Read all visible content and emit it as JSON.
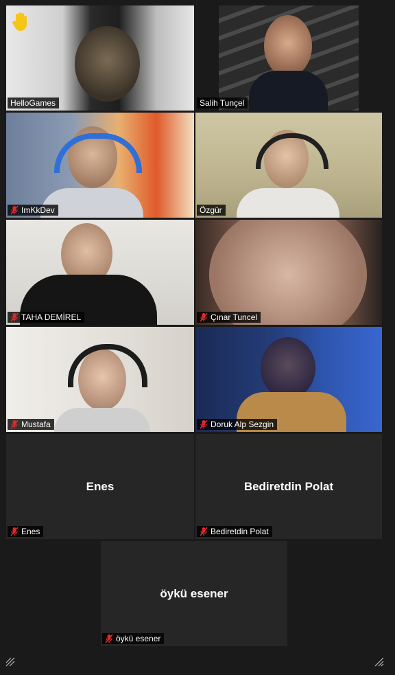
{
  "participants": [
    {
      "name": "HelloGames",
      "muted": false,
      "raised_hand": true
    },
    {
      "name": "Salih Tunçel",
      "muted": false
    },
    {
      "name": "ImKkDev",
      "muted": true
    },
    {
      "name": "Özgür",
      "muted": false
    },
    {
      "name": "TAHA DEMİREL",
      "muted": true
    },
    {
      "name": "Çınar Tuncel",
      "muted": true
    },
    {
      "name": "Mustafa",
      "muted": true
    },
    {
      "name": "Doruk Alp Sezgin",
      "muted": true
    },
    {
      "name": "Enes",
      "muted": true,
      "video_off": true
    },
    {
      "name": "Bediretdin Polat",
      "muted": true,
      "video_off": true
    },
    {
      "name": "öykü esener",
      "muted": true,
      "video_off": true
    }
  ],
  "colors": {
    "background": "#1a1a1a",
    "tile_empty": "#262626",
    "active_speaker_border": "#a2d24a",
    "mute_icon": "#e02828",
    "hand_icon": "#f5c518"
  },
  "icons": {
    "raised_hand": "raised-hand-icon",
    "mic_off": "mic-muted-icon",
    "resize": "resize-grip-icon"
  }
}
